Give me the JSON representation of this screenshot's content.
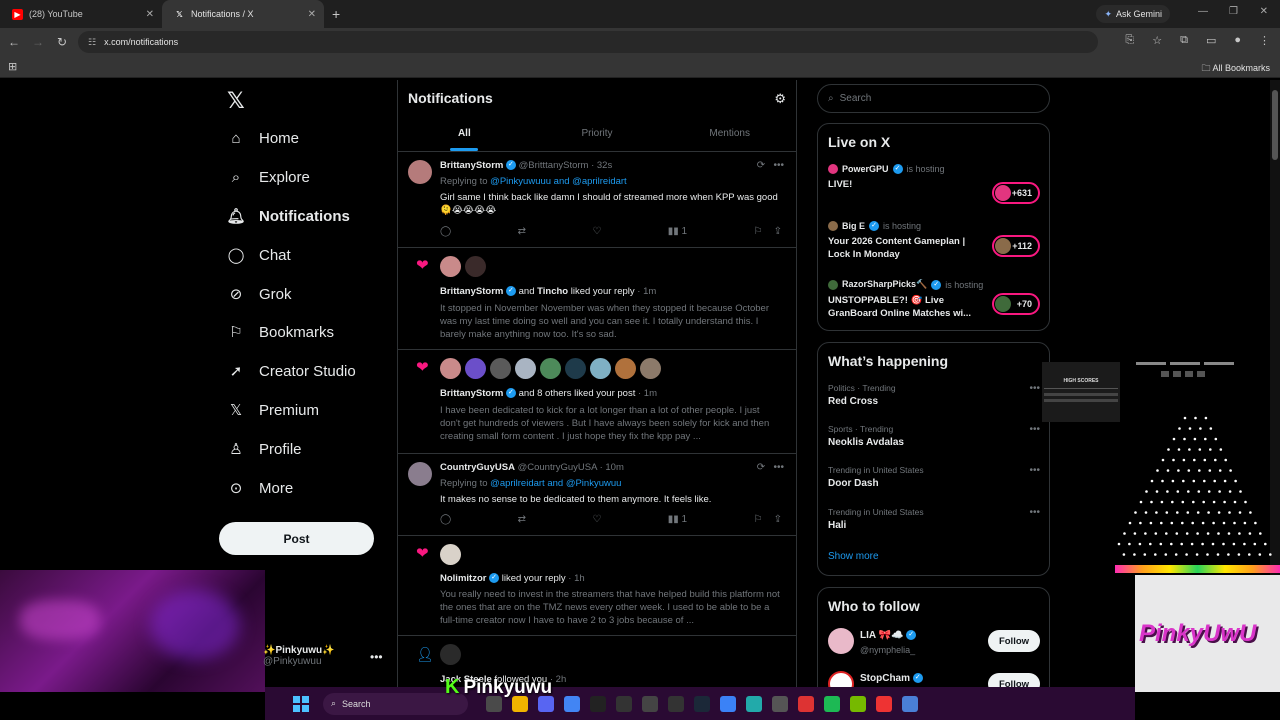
{
  "browser": {
    "tabs": [
      {
        "title": "(28) YouTube",
        "active": false,
        "favicon_color": "#ff0000"
      },
      {
        "title": "Notifications / X",
        "active": true,
        "favicon_color": "#ffffff"
      }
    ],
    "ask_gemini": "Ask Gemini",
    "url": "x.com/notifications",
    "all_bookmarks": "All Bookmarks"
  },
  "nav": {
    "items": [
      {
        "label": "Home",
        "icon": "home-icon"
      },
      {
        "label": "Explore",
        "icon": "search-icon"
      },
      {
        "label": "Notifications",
        "icon": "bell-icon"
      },
      {
        "label": "Chat",
        "icon": "chat-icon"
      },
      {
        "label": "Grok",
        "icon": "grok-icon"
      },
      {
        "label": "Bookmarks",
        "icon": "bookmark-icon"
      },
      {
        "label": "Creator Studio",
        "icon": "rocket-icon"
      },
      {
        "label": "Premium",
        "icon": "x-icon"
      },
      {
        "label": "Profile",
        "icon": "person-icon"
      },
      {
        "label": "More",
        "icon": "more-icon"
      }
    ],
    "post": "Post"
  },
  "account": {
    "name": "✨Pinkyuwu✨",
    "handle": "@Pinkyuwuu"
  },
  "notifications": {
    "title": "Notifications",
    "tabs": [
      "All",
      "Priority",
      "Mentions"
    ],
    "items": [
      {
        "name": "BrittanyStorm",
        "handle": "@BritttanyStorm",
        "time": "· 32s",
        "replying_prefix": "Replying to ",
        "replying_to": "@Pinkyuwuuu and @aprilreidart",
        "text": "Girl same I think back like damn I should of streamed more when KPP was good 🫠😭😭😭😭",
        "views": "1"
      },
      {
        "name": "BrittanyStorm",
        "rest": "and",
        "name2": "Tincho",
        "action": "liked your reply",
        "time": "· 1m",
        "text": "It stopped in November November was when they stopped it because October was my last time doing so well and you can see it. I totally understand this. I barely make anything now too. It's so sad."
      },
      {
        "name": "BrittanyStorm",
        "action": "and 8 others liked your post",
        "time": "· 1m",
        "text": "I have been dedicated to kick for a lot longer than a lot of other people. I just don't get hundreds of viewers . But I have always been solely for kick and then creating small form content . I just hope they fix the kpp pay ..."
      },
      {
        "name": "CountryGuyUSA",
        "handle": "@CountryGuyUSA",
        "time": "· 10m",
        "replying_prefix": "Replying to ",
        "replying_to": "@aprilreidart and @Pinkyuwuu",
        "text": "It makes no sense to be dedicated to them anymore. It feels like.",
        "views": "1"
      },
      {
        "name": "Nolimitzor",
        "action": "liked your reply",
        "time": "· 1h",
        "text": "You really need to invest in the streamers that have helped build this platform not the ones that are on the TMZ news every other week. I used to be able to be a full-time creator now I have to have 2 to 3 jobs because of ..."
      },
      {
        "name": "Jack Steele",
        "action": "followed you",
        "time": "· 2h"
      }
    ]
  },
  "right": {
    "search_placeholder": "Search",
    "live": {
      "title": "Live on X",
      "hosting": "is hosting",
      "items": [
        {
          "host": "PowerGPU",
          "title": "LIVE!",
          "count": "+631"
        },
        {
          "host": "Big E",
          "title": "Your 2026 Content Gameplan | Lock In Monday",
          "count": "+112"
        },
        {
          "host": "RazorSharpPicks🔨",
          "title": "UNSTOPPABLE?! 🎯 Live GranBoard Online Matches wi...",
          "count": "+70"
        }
      ]
    },
    "happening": {
      "title": "What’s happening",
      "items": [
        {
          "context": "Politics · Trending",
          "title": "Red Cross"
        },
        {
          "context": "Sports · Trending",
          "title": "Neoklis Avdalas"
        },
        {
          "context": "Trending in United States",
          "title": "Door Dash"
        },
        {
          "context": "Trending in United States",
          "title": "Hali"
        }
      ],
      "show_more": "Show more"
    },
    "follow": {
      "title": "Who to follow",
      "items": [
        {
          "name": "LIA 🎀☁️",
          "handle": "@nymphelia_",
          "button": "Follow"
        },
        {
          "name": "StopCham",
          "handle": "",
          "button": "Follow"
        }
      ]
    }
  },
  "overlay": {
    "streamer": "Pinkyuwu",
    "scoreboard_title": "HIGH SCORES",
    "brand": "PinkyUwU"
  },
  "taskbar": {
    "search": "Search"
  }
}
